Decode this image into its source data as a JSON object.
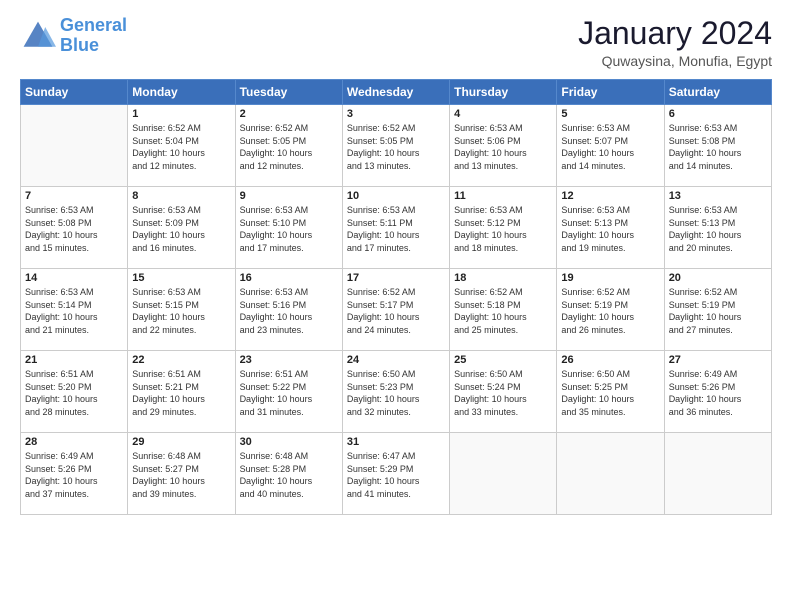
{
  "header": {
    "logo_line1": "General",
    "logo_line2": "Blue",
    "month_title": "January 2024",
    "subtitle": "Quwaysina, Monufia, Egypt"
  },
  "weekdays": [
    "Sunday",
    "Monday",
    "Tuesday",
    "Wednesday",
    "Thursday",
    "Friday",
    "Saturday"
  ],
  "weeks": [
    [
      {
        "day": null,
        "info": null
      },
      {
        "day": "1",
        "info": "Sunrise: 6:52 AM\nSunset: 5:04 PM\nDaylight: 10 hours\nand 12 minutes."
      },
      {
        "day": "2",
        "info": "Sunrise: 6:52 AM\nSunset: 5:05 PM\nDaylight: 10 hours\nand 12 minutes."
      },
      {
        "day": "3",
        "info": "Sunrise: 6:52 AM\nSunset: 5:05 PM\nDaylight: 10 hours\nand 13 minutes."
      },
      {
        "day": "4",
        "info": "Sunrise: 6:53 AM\nSunset: 5:06 PM\nDaylight: 10 hours\nand 13 minutes."
      },
      {
        "day": "5",
        "info": "Sunrise: 6:53 AM\nSunset: 5:07 PM\nDaylight: 10 hours\nand 14 minutes."
      },
      {
        "day": "6",
        "info": "Sunrise: 6:53 AM\nSunset: 5:08 PM\nDaylight: 10 hours\nand 14 minutes."
      }
    ],
    [
      {
        "day": "7",
        "info": "Sunrise: 6:53 AM\nSunset: 5:08 PM\nDaylight: 10 hours\nand 15 minutes."
      },
      {
        "day": "8",
        "info": "Sunrise: 6:53 AM\nSunset: 5:09 PM\nDaylight: 10 hours\nand 16 minutes."
      },
      {
        "day": "9",
        "info": "Sunrise: 6:53 AM\nSunset: 5:10 PM\nDaylight: 10 hours\nand 17 minutes."
      },
      {
        "day": "10",
        "info": "Sunrise: 6:53 AM\nSunset: 5:11 PM\nDaylight: 10 hours\nand 17 minutes."
      },
      {
        "day": "11",
        "info": "Sunrise: 6:53 AM\nSunset: 5:12 PM\nDaylight: 10 hours\nand 18 minutes."
      },
      {
        "day": "12",
        "info": "Sunrise: 6:53 AM\nSunset: 5:13 PM\nDaylight: 10 hours\nand 19 minutes."
      },
      {
        "day": "13",
        "info": "Sunrise: 6:53 AM\nSunset: 5:13 PM\nDaylight: 10 hours\nand 20 minutes."
      }
    ],
    [
      {
        "day": "14",
        "info": "Sunrise: 6:53 AM\nSunset: 5:14 PM\nDaylight: 10 hours\nand 21 minutes."
      },
      {
        "day": "15",
        "info": "Sunrise: 6:53 AM\nSunset: 5:15 PM\nDaylight: 10 hours\nand 22 minutes."
      },
      {
        "day": "16",
        "info": "Sunrise: 6:53 AM\nSunset: 5:16 PM\nDaylight: 10 hours\nand 23 minutes."
      },
      {
        "day": "17",
        "info": "Sunrise: 6:52 AM\nSunset: 5:17 PM\nDaylight: 10 hours\nand 24 minutes."
      },
      {
        "day": "18",
        "info": "Sunrise: 6:52 AM\nSunset: 5:18 PM\nDaylight: 10 hours\nand 25 minutes."
      },
      {
        "day": "19",
        "info": "Sunrise: 6:52 AM\nSunset: 5:19 PM\nDaylight: 10 hours\nand 26 minutes."
      },
      {
        "day": "20",
        "info": "Sunrise: 6:52 AM\nSunset: 5:19 PM\nDaylight: 10 hours\nand 27 minutes."
      }
    ],
    [
      {
        "day": "21",
        "info": "Sunrise: 6:51 AM\nSunset: 5:20 PM\nDaylight: 10 hours\nand 28 minutes."
      },
      {
        "day": "22",
        "info": "Sunrise: 6:51 AM\nSunset: 5:21 PM\nDaylight: 10 hours\nand 29 minutes."
      },
      {
        "day": "23",
        "info": "Sunrise: 6:51 AM\nSunset: 5:22 PM\nDaylight: 10 hours\nand 31 minutes."
      },
      {
        "day": "24",
        "info": "Sunrise: 6:50 AM\nSunset: 5:23 PM\nDaylight: 10 hours\nand 32 minutes."
      },
      {
        "day": "25",
        "info": "Sunrise: 6:50 AM\nSunset: 5:24 PM\nDaylight: 10 hours\nand 33 minutes."
      },
      {
        "day": "26",
        "info": "Sunrise: 6:50 AM\nSunset: 5:25 PM\nDaylight: 10 hours\nand 35 minutes."
      },
      {
        "day": "27",
        "info": "Sunrise: 6:49 AM\nSunset: 5:26 PM\nDaylight: 10 hours\nand 36 minutes."
      }
    ],
    [
      {
        "day": "28",
        "info": "Sunrise: 6:49 AM\nSunset: 5:26 PM\nDaylight: 10 hours\nand 37 minutes."
      },
      {
        "day": "29",
        "info": "Sunrise: 6:48 AM\nSunset: 5:27 PM\nDaylight: 10 hours\nand 39 minutes."
      },
      {
        "day": "30",
        "info": "Sunrise: 6:48 AM\nSunset: 5:28 PM\nDaylight: 10 hours\nand 40 minutes."
      },
      {
        "day": "31",
        "info": "Sunrise: 6:47 AM\nSunset: 5:29 PM\nDaylight: 10 hours\nand 41 minutes."
      },
      {
        "day": null,
        "info": null
      },
      {
        "day": null,
        "info": null
      },
      {
        "day": null,
        "info": null
      }
    ]
  ]
}
